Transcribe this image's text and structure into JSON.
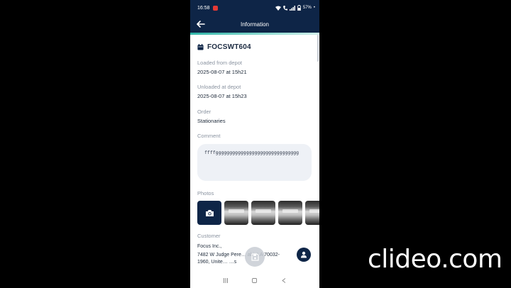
{
  "status_bar": {
    "time": "16:58",
    "battery": "57%"
  },
  "app_bar": {
    "title": "Information"
  },
  "delivery": {
    "vehicle_id": "FOCSWT604",
    "loaded_label": "Loaded from depot",
    "loaded_value": "2025-08-07 at 15h21",
    "unloaded_label": "Unloaded at depot",
    "unloaded_value": "2025-08-07 at 15h23",
    "order_label": "Order",
    "order_value": "Stationaries",
    "comment_label": "Comment",
    "comment_value": "ffffgggggggggggggggggggggggggggggg",
    "photos_label": "Photos",
    "customer_label": "Customer",
    "customer_name": "Focus Inc.,",
    "customer_address": "7482 W Judge Pere… abi, LA 70032-1960, Unite… …s"
  },
  "watermark": "clideo.com",
  "colors": {
    "primary": "#0e2547",
    "accent": "#2fb5a8"
  }
}
